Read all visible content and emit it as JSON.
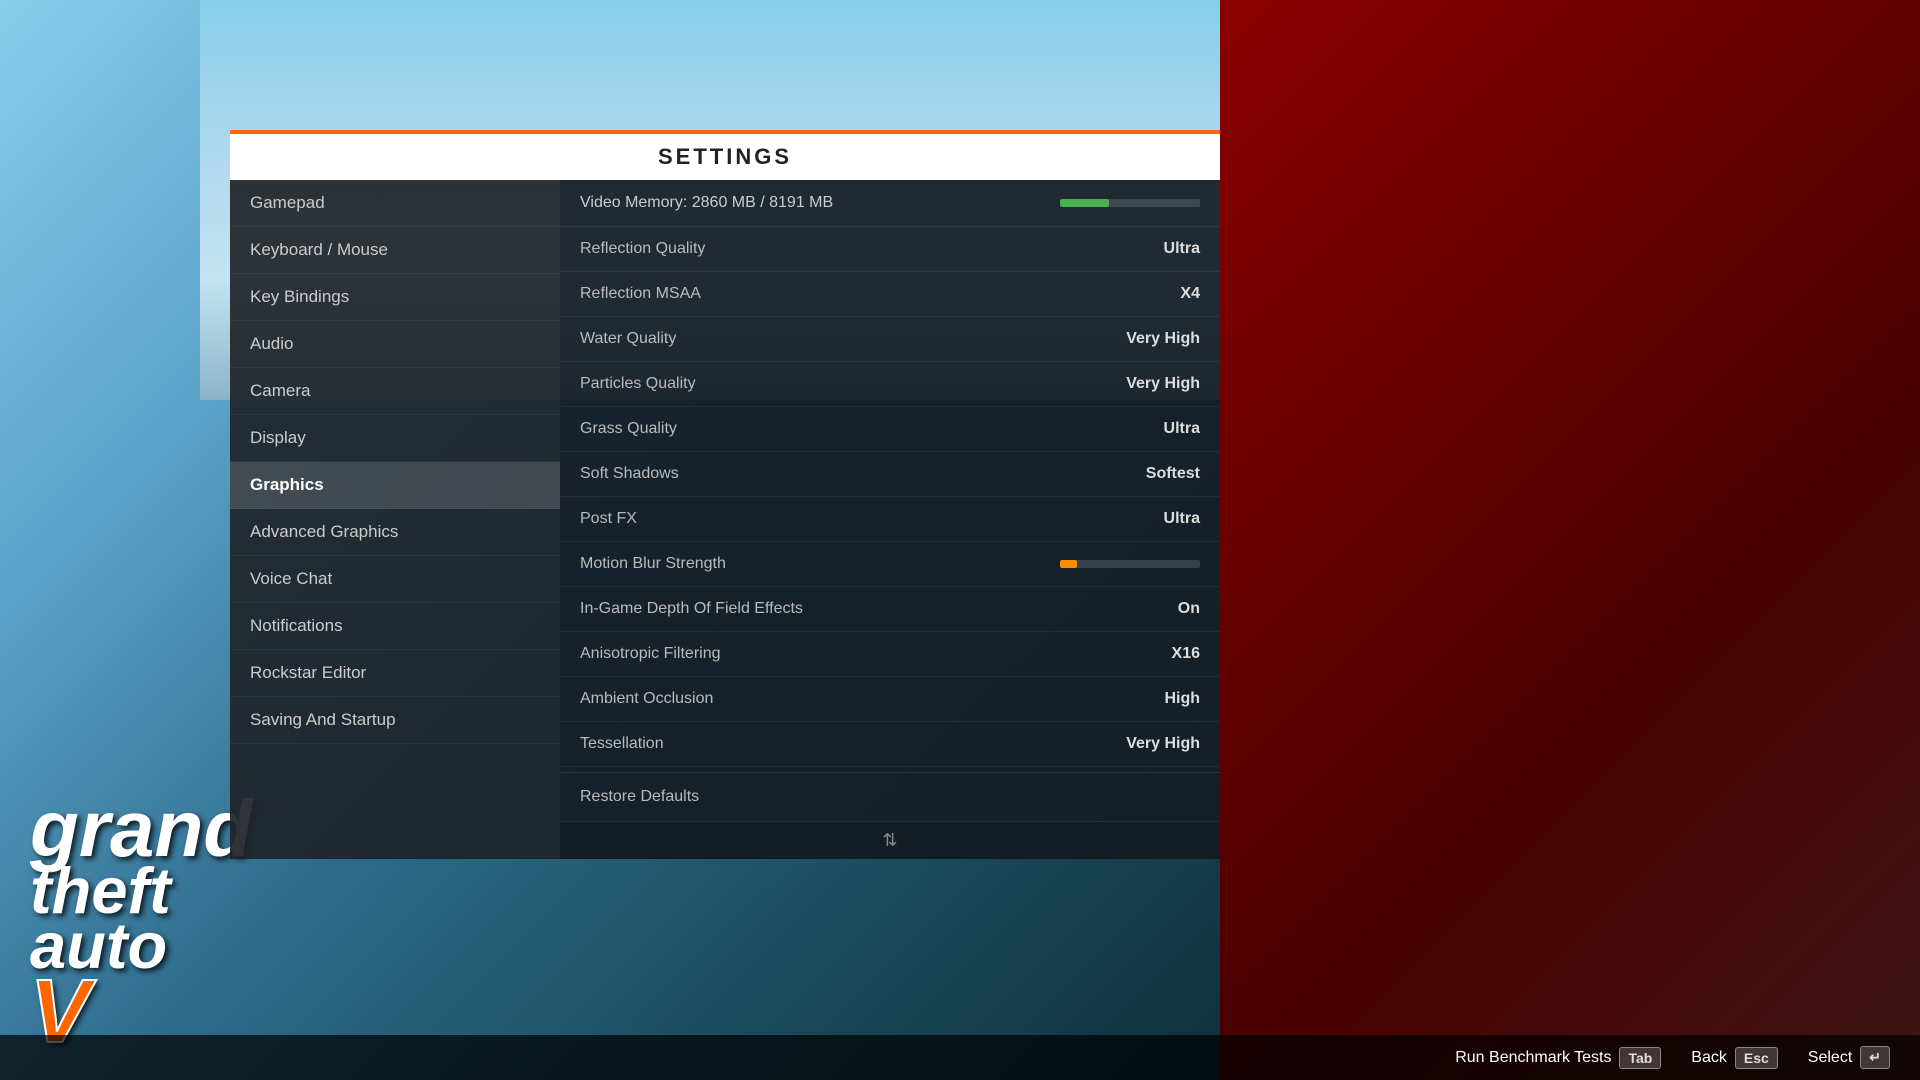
{
  "background": {
    "sky_color": "#87CEEB"
  },
  "settings": {
    "title": "SETTINGS",
    "nav_items": [
      {
        "id": "gamepad",
        "label": "Gamepad",
        "active": false
      },
      {
        "id": "keyboard-mouse",
        "label": "Keyboard / Mouse",
        "active": false
      },
      {
        "id": "key-bindings",
        "label": "Key Bindings",
        "active": false
      },
      {
        "id": "audio",
        "label": "Audio",
        "active": false
      },
      {
        "id": "camera",
        "label": "Camera",
        "active": false
      },
      {
        "id": "display",
        "label": "Display",
        "active": false
      },
      {
        "id": "graphics",
        "label": "Graphics",
        "active": true
      },
      {
        "id": "advanced-graphics",
        "label": "Advanced Graphics",
        "active": false
      },
      {
        "id": "voice-chat",
        "label": "Voice Chat",
        "active": false
      },
      {
        "id": "notifications",
        "label": "Notifications",
        "active": false
      },
      {
        "id": "rockstar-editor",
        "label": "Rockstar Editor",
        "active": false
      },
      {
        "id": "saving-startup",
        "label": "Saving And Startup",
        "active": false
      }
    ],
    "video_memory": {
      "label": "Video Memory: 2860 MB / 8191 MB",
      "bar_percent": 35
    },
    "settings_rows": [
      {
        "id": "reflection-quality",
        "name": "Reflection Quality",
        "value": "Ultra"
      },
      {
        "id": "reflection-msaa",
        "name": "Reflection MSAA",
        "value": "X4"
      },
      {
        "id": "water-quality",
        "name": "Water Quality",
        "value": "Very High"
      },
      {
        "id": "particles-quality",
        "name": "Particles Quality",
        "value": "Very High"
      },
      {
        "id": "grass-quality",
        "name": "Grass Quality",
        "value": "Ultra"
      },
      {
        "id": "soft-shadows",
        "name": "Soft Shadows",
        "value": "Softest"
      },
      {
        "id": "post-fx",
        "name": "Post FX",
        "value": "Ultra"
      },
      {
        "id": "motion-blur",
        "name": "Motion Blur Strength",
        "value": "bar"
      },
      {
        "id": "depth-field",
        "name": "In-Game Depth Of Field Effects",
        "value": "On"
      },
      {
        "id": "anisotropic",
        "name": "Anisotropic Filtering",
        "value": "X16"
      },
      {
        "id": "ambient-occlusion",
        "name": "Ambient Occlusion",
        "value": "High"
      },
      {
        "id": "tessellation",
        "name": "Tessellation",
        "value": "Very High"
      }
    ],
    "restore_defaults": "Restore Defaults"
  },
  "bottom_bar": {
    "benchmark_label": "Run Benchmark Tests",
    "benchmark_key": "Tab",
    "back_label": "Back",
    "back_key": "Esc",
    "select_label": "Select",
    "select_key": "↵"
  },
  "gta_logo": {
    "grand": "grand",
    "theft": "theft",
    "auto": "auto",
    "five": "V"
  }
}
